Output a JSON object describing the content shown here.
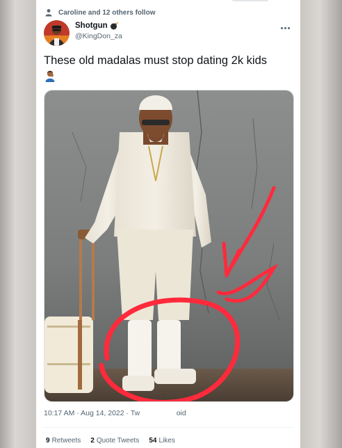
{
  "tweet": {
    "social_context": "Caroline and 12 others follow",
    "author": {
      "display_name": "Shotgun",
      "handle": "@KingDon_za"
    },
    "text": "These old madalas must stop dating 2k kids",
    "time": "10:17 AM",
    "date": "Aug 14, 2022",
    "client_fragment": "Tw",
    "client_tail": "oid",
    "stats": [
      {
        "count": "9",
        "label": "Retweets"
      },
      {
        "count": "2",
        "label": "Quote Tweets"
      },
      {
        "count": "54",
        "label": "Likes"
      }
    ],
    "icons": {
      "social_context": "person-icon",
      "name_emoji": "bomb-icon",
      "text_emoji": "facepalm-person-icon",
      "menu": "more-icon"
    },
    "colors": {
      "primary_text": "#0f1419",
      "secondary_text": "#536471",
      "annotation": "#ff2a3c"
    }
  }
}
